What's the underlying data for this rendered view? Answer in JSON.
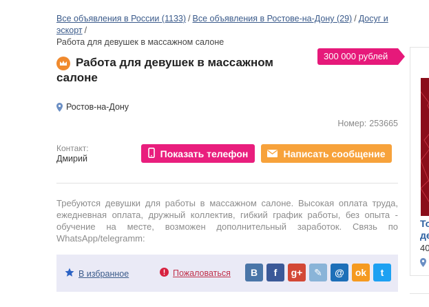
{
  "breadcrumbs": {
    "items": [
      {
        "label": "Все объявления в России (1133)"
      },
      {
        "label": "Все объявления в Ростове-на-Дону (29)"
      },
      {
        "label": "Досуг и эскорт"
      }
    ],
    "separator": "/",
    "current": "Работа для девушек в массажном салоне"
  },
  "listing": {
    "title": "Работа для девушек в массажном салоне",
    "price": "300 000 рублей",
    "location": "Ростов-на-Дону",
    "number_label": "Номер:",
    "number_value": "253665",
    "contact_label": "Контакт:",
    "contact_name": "Дмирий",
    "description": "Требуются девушки для работы в массажном салоне. Высокая оплата труда, ежедневная оплата, дружный коллектив, гибкий график работы, без опыта - обучение на месте, возможен дополнительный заработок. Связь по WhatsApp/telegramm: "
  },
  "buttons": {
    "show_phone": "Показать телефон",
    "write_message": "Написать сообщение"
  },
  "actions": {
    "favorite": "В избранное",
    "complain": "Пожаловаться"
  },
  "socials": [
    {
      "name": "vk",
      "glyph": "В",
      "color": "#4a76a8"
    },
    {
      "name": "facebook",
      "glyph": "f",
      "color": "#3b5998"
    },
    {
      "name": "google-plus",
      "glyph": "g+",
      "color": "#d34836"
    },
    {
      "name": "livejournal",
      "glyph": "✎",
      "color": "#8ab4d8"
    },
    {
      "name": "mail",
      "glyph": "@",
      "color": "#1d6fb8"
    },
    {
      "name": "odnoklassniki",
      "glyph": "ok",
      "color": "#f59a20"
    },
    {
      "name": "twitter",
      "glyph": "t",
      "color": "#1da1f2"
    }
  ],
  "sidebar": {
    "title_fragment": "То\nде",
    "number_fragment": "40"
  },
  "colors": {
    "accent_pink": "#e91e7d",
    "accent_orange": "#f7a23b",
    "link_blue": "#3a5a8a"
  }
}
